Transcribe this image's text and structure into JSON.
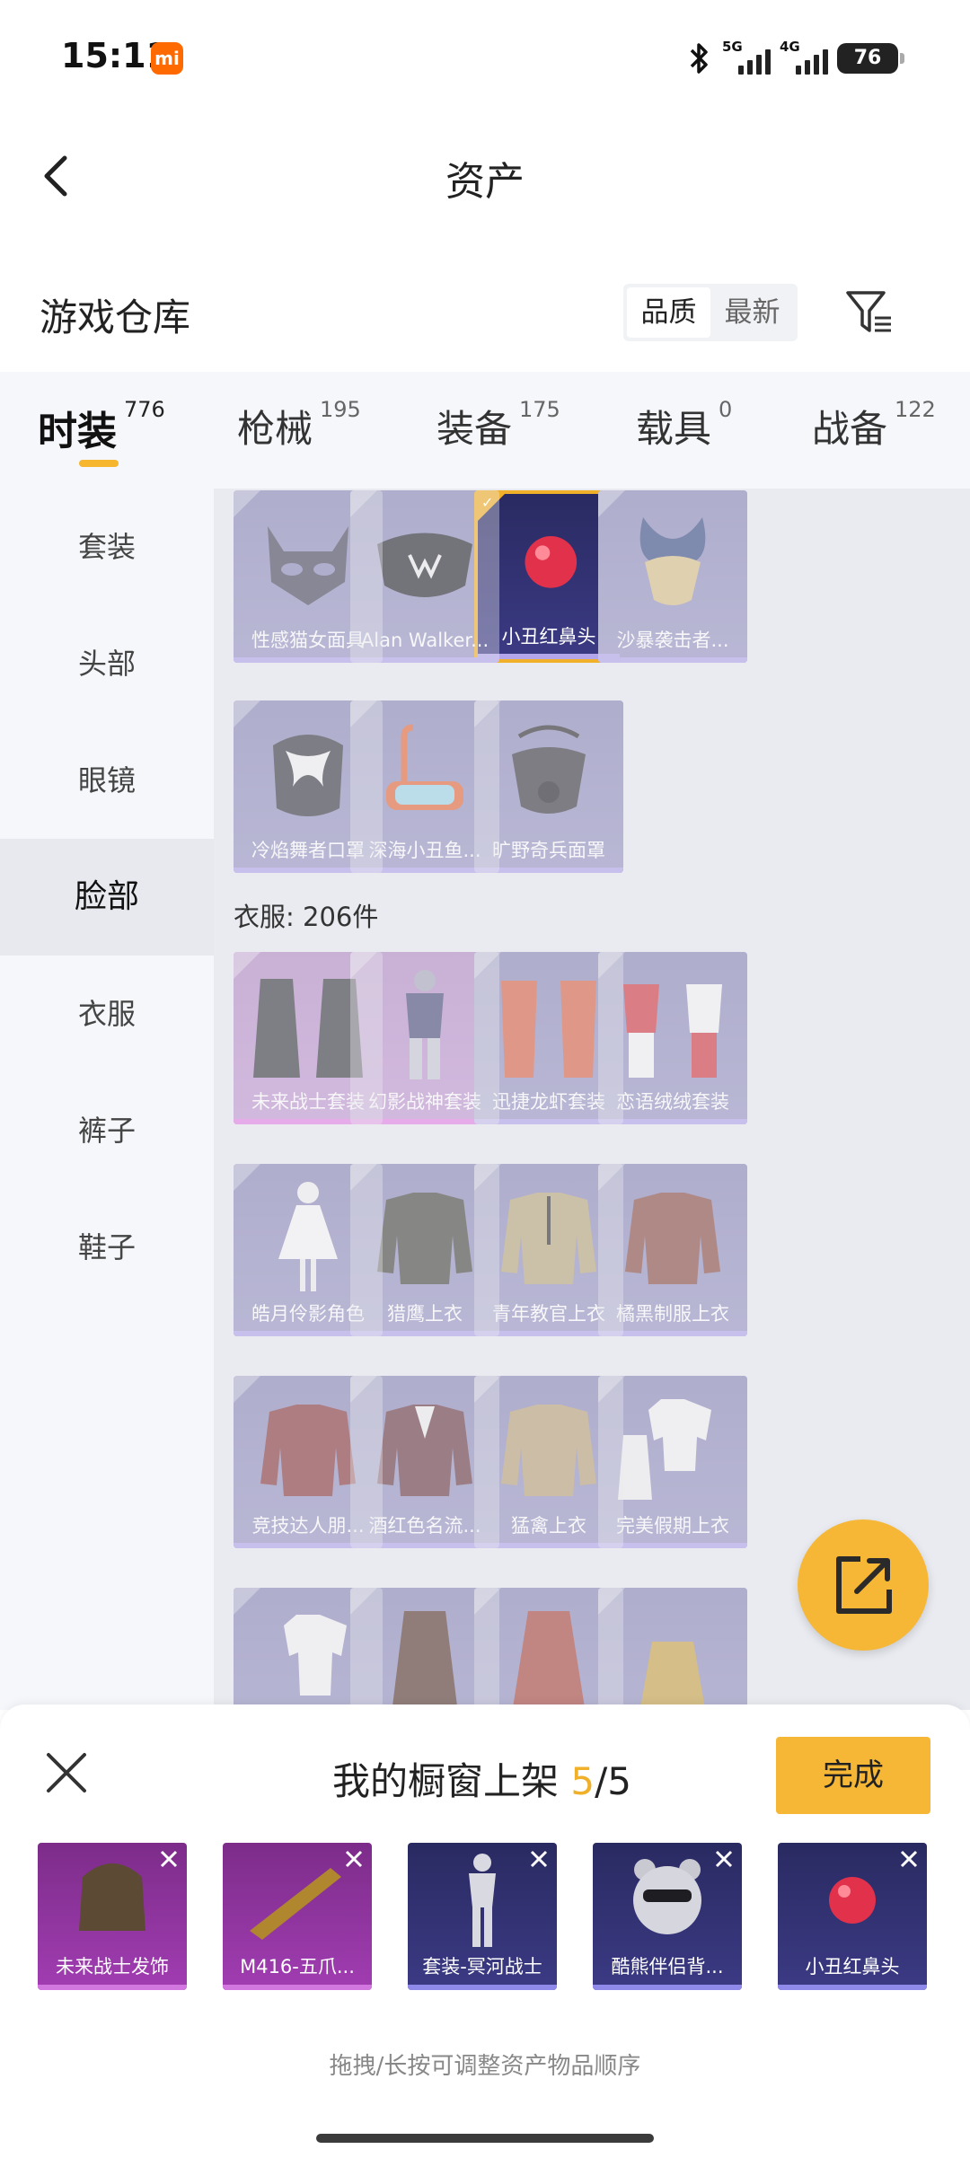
{
  "status_bar": {
    "time": "15:11",
    "mi_badge": "mi",
    "signal_1": "5G",
    "signal_2": "4G",
    "battery": "76"
  },
  "header": {
    "title": "资产"
  },
  "warehouse": {
    "title": "游戏仓库",
    "sort_options": [
      "品质",
      "最新"
    ],
    "sort_active": "品质"
  },
  "category_tabs": [
    {
      "name": "时装",
      "count": "776"
    },
    {
      "name": "枪械",
      "count": "195"
    },
    {
      "name": "装备",
      "count": "175"
    },
    {
      "name": "载具",
      "count": "0"
    },
    {
      "name": "战备",
      "count": "122"
    }
  ],
  "sidebar": {
    "items": [
      "套装",
      "头部",
      "眼镜",
      "脸部",
      "衣服",
      "裤子",
      "鞋子"
    ],
    "active": "脸部"
  },
  "face_items": [
    {
      "name": "性感猫女面具",
      "art": "cat-mask-icon"
    },
    {
      "name": "Alan Walker...",
      "art": "face-mask-icon"
    },
    {
      "name": "小丑红鼻头",
      "art": "clown-nose-icon",
      "selected": true
    },
    {
      "name": "沙暴袭击者...",
      "art": "golden-mask-icon"
    },
    {
      "name": "冷焰舞者口罩",
      "art": "flame-mask-icon"
    },
    {
      "name": "深海小丑鱼...",
      "art": "snorkel-icon"
    },
    {
      "name": "旷野奇兵面罩",
      "art": "respirator-icon"
    }
  ],
  "clothes_section": {
    "label": "衣服: 206件"
  },
  "clothes_items": [
    {
      "name": "未来战士套装",
      "tint": "pink"
    },
    {
      "name": "幻影战神套装",
      "tint": "pink"
    },
    {
      "name": "迅捷龙虾套装",
      "tint": "blue"
    },
    {
      "name": "恋语绒绒套装",
      "tint": "blue"
    },
    {
      "name": "皓月伶影角色",
      "tint": "blue"
    },
    {
      "name": "猎鹰上衣",
      "tint": "blue"
    },
    {
      "name": "青年教官上衣",
      "tint": "blue"
    },
    {
      "name": "橘黑制服上衣",
      "tint": "blue"
    },
    {
      "name": "竞技达人朋...",
      "tint": "blue"
    },
    {
      "name": "酒红色名流...",
      "tint": "blue"
    },
    {
      "name": "猛禽上衣",
      "tint": "blue"
    },
    {
      "name": "完美假期上衣",
      "tint": "blue"
    },
    {
      "name": "",
      "tint": "blue"
    },
    {
      "name": "",
      "tint": "blue"
    },
    {
      "name": "",
      "tint": "blue"
    },
    {
      "name": "",
      "tint": "blue"
    }
  ],
  "bottom_panel": {
    "title_prefix": "我的橱窗上架 ",
    "current": "5",
    "separator": "/",
    "total": "5",
    "done_label": "完成",
    "showcase": [
      {
        "name": "未来战士发饰",
        "tint": "purple"
      },
      {
        "name": "M416-五爪...",
        "tint": "purple"
      },
      {
        "name": "套装-冥河战士",
        "tint": "navy"
      },
      {
        "name": "酷熊伴侣背...",
        "tint": "navy"
      },
      {
        "name": "小丑红鼻头",
        "tint": "navy"
      }
    ],
    "hint": "拖拽/长按可调整资产物品顺序"
  },
  "colors": {
    "accent": "#f5b735",
    "item_blue": "#9a98c4",
    "item_pink": "#c39bd3",
    "selected_border": "#f0b02a"
  }
}
